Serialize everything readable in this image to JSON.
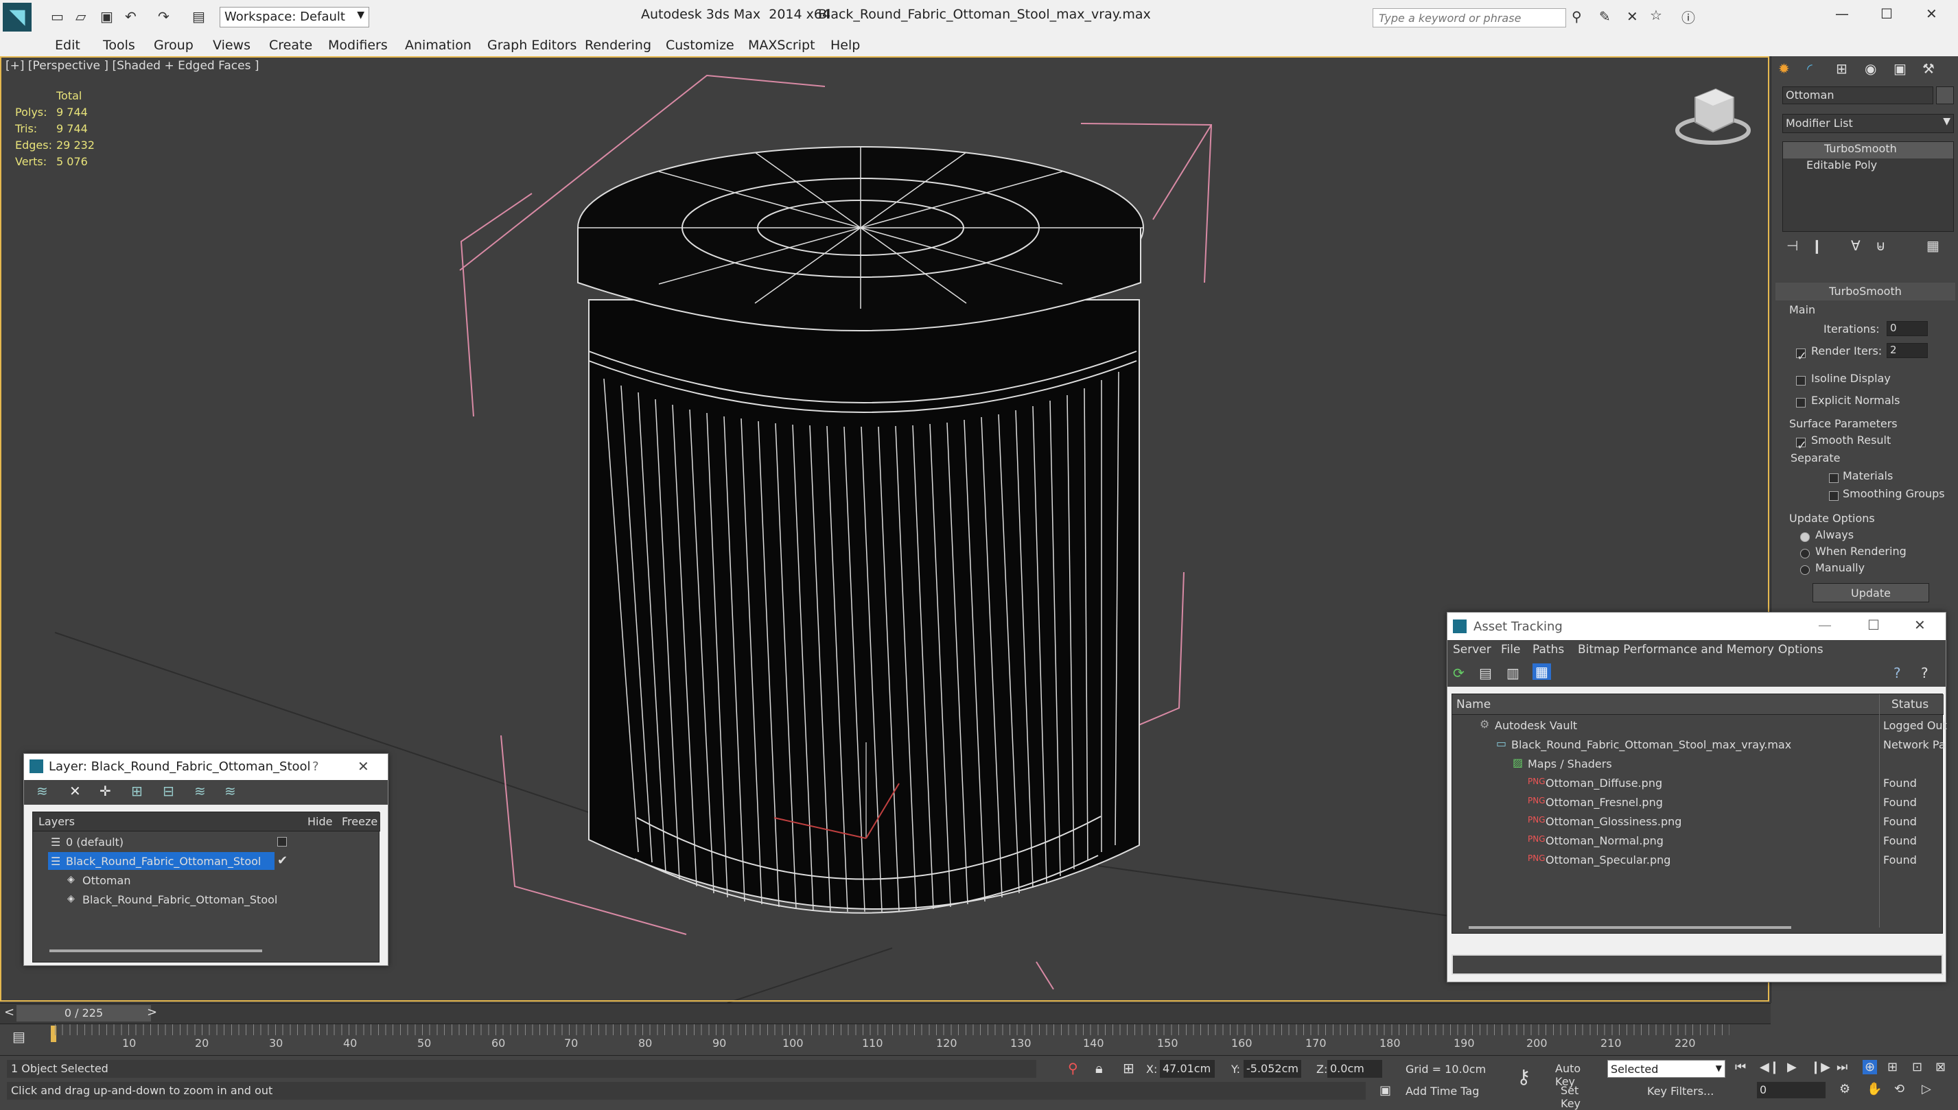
{
  "title": {
    "app": "Autodesk 3ds Max  2014 x64",
    "file": "Black_Round_Fabric_Ottoman_Stool_max_vray.max",
    "workspace": "Workspace: Default",
    "search_placeholder": "Type a keyword or phrase"
  },
  "menu": [
    "Edit",
    "Tools",
    "Group",
    "Views",
    "Create",
    "Modifiers",
    "Animation",
    "Graph Editors",
    "Rendering",
    "Customize",
    "MAXScript",
    "Help"
  ],
  "viewport": {
    "label": "[+] [Perspective ] [Shaded + Edged Faces ]",
    "stats": {
      "header": "Total",
      "rows": [
        [
          "Polys:",
          "9 744"
        ],
        [
          "Tris:",
          "9 744"
        ],
        [
          "Edges:",
          "29 232"
        ],
        [
          "Verts:",
          "5 076"
        ]
      ]
    }
  },
  "command_panel": {
    "object_name": "Ottoman",
    "modifier_list": "Modifier List",
    "stack": [
      "TurboSmooth",
      "Editable Poly"
    ],
    "rollout_title": "TurboSmooth",
    "main_label": "Main",
    "iterations_label": "Iterations:",
    "iterations_value": "0",
    "render_iters_label": "Render Iters:",
    "render_iters_value": "2",
    "isoline": "Isoline Display",
    "explicit": "Explicit Normals",
    "surface_params": "Surface Parameters",
    "smooth_result": "Smooth Result",
    "separate": "Separate",
    "materials": "Materials",
    "smoothing_groups": "Smoothing Groups",
    "update_options": "Update Options",
    "always": "Always",
    "when_rendering": "When Rendering",
    "manually": "Manually",
    "update_btn": "Update"
  },
  "layer_window": {
    "title": "Layer: Black_Round_Fabric_Ottoman_Stool",
    "help": "?",
    "col_layers": "Layers",
    "col_hide": "Hide",
    "col_freeze": "Freeze",
    "rows": [
      "0 (default)",
      "Black_Round_Fabric_Ottoman_Stool",
      "Ottoman",
      "Black_Round_Fabric_Ottoman_Stool"
    ]
  },
  "asset_window": {
    "title": "Asset Tracking",
    "menu": [
      "Server",
      "File",
      "Paths",
      "Bitmap Performance and Memory",
      "Options"
    ],
    "col_name": "Name",
    "col_status": "Status",
    "rows": [
      {
        "name": "Autodesk Vault",
        "status": "Logged Out"
      },
      {
        "name": "Black_Round_Fabric_Ottoman_Stool_max_vray.max",
        "status": "Network Pa"
      },
      {
        "name": "Maps / Shaders",
        "status": ""
      },
      {
        "name": "Ottoman_Diffuse.png",
        "status": "Found"
      },
      {
        "name": "Ottoman_Fresnel.png",
        "status": "Found"
      },
      {
        "name": "Ottoman_Glossiness.png",
        "status": "Found"
      },
      {
        "name": "Ottoman_Normal.png",
        "status": "Found"
      },
      {
        "name": "Ottoman_Specular.png",
        "status": "Found"
      }
    ]
  },
  "timeline": {
    "frame": "0 / 225",
    "ticks": [
      "10",
      "20",
      "30",
      "40",
      "50",
      "60",
      "70",
      "80",
      "90",
      "100",
      "110",
      "120",
      "130",
      "140",
      "150",
      "160",
      "170",
      "180",
      "190",
      "200",
      "210",
      "220"
    ]
  },
  "status": {
    "selected": "1 Object Selected",
    "hint": "Click and drag up-and-down to zoom in and out",
    "x_label": "X:",
    "x_value": "47.01cm",
    "y_label": "Y:",
    "y_value": "-5.052cm",
    "z_label": "Z:",
    "z_value": "0.0cm",
    "grid": "Grid = 10.0cm",
    "auto_key": "Auto Key",
    "set_key": "Set Key",
    "key_mode": "Selected",
    "key_filters": "Key Filters...",
    "add_time_tag": "Add Time Tag",
    "frame_value": "0"
  }
}
